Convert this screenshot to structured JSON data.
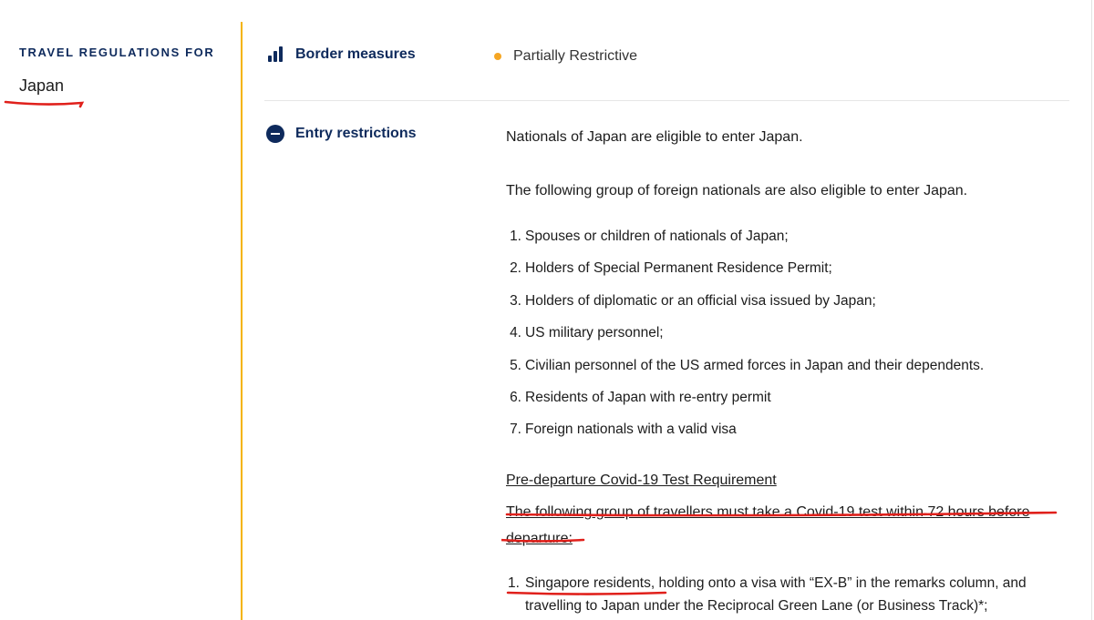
{
  "sidebar": {
    "kicker": "TRAVEL REGULATIONS FOR",
    "country": "Japan"
  },
  "sections": {
    "border": {
      "label": "Border measures",
      "icon": "bar-chart-icon",
      "status_text": "Partially Restrictive",
      "status_color": "#f5a623"
    },
    "entry": {
      "label": "Entry restrictions",
      "icon": "minus-circle-icon",
      "intro": "Nationals of Japan are eligible to enter Japan.",
      "group_intro": "The following group of foreign nationals are also eligible to enter Japan.",
      "eligible_groups": [
        {
          "num": "1.",
          "text": "Spouses or children of nationals of Japan;"
        },
        {
          "num": "2.",
          "text": "Holders of Special Permanent Residence Permit;"
        },
        {
          "num": "3.",
          "text": "Holders of diplomatic or an official visa issued by Japan;"
        },
        {
          "num": "4.",
          "text": "US military personnel;"
        },
        {
          "num": "5.",
          "text": "Civilian personnel of the US armed forces in Japan and their dependents."
        },
        {
          "num": "6.",
          "text": "Residents of Japan with re-entry permit"
        },
        {
          "num": "7.",
          "text": "Foreign nationals with a valid visa"
        }
      ],
      "pre_departure_title": "Pre-departure Covid-19 Test Requirement",
      "pre_departure_body": "The following group of travellers must take a Covid-19 test within 72 hours before departure:",
      "test_groups": [
        {
          "num": "1.",
          "text": "Singapore residents, holding onto a visa with “EX-B” in the remarks column, and travelling to Japan under the Reciprocal Green Lane (or Business Track)*;"
        }
      ]
    }
  },
  "theme": {
    "accent_rule": "#f4b400",
    "navy": "#0e2a5c",
    "annotation_red": "#e0201b"
  }
}
